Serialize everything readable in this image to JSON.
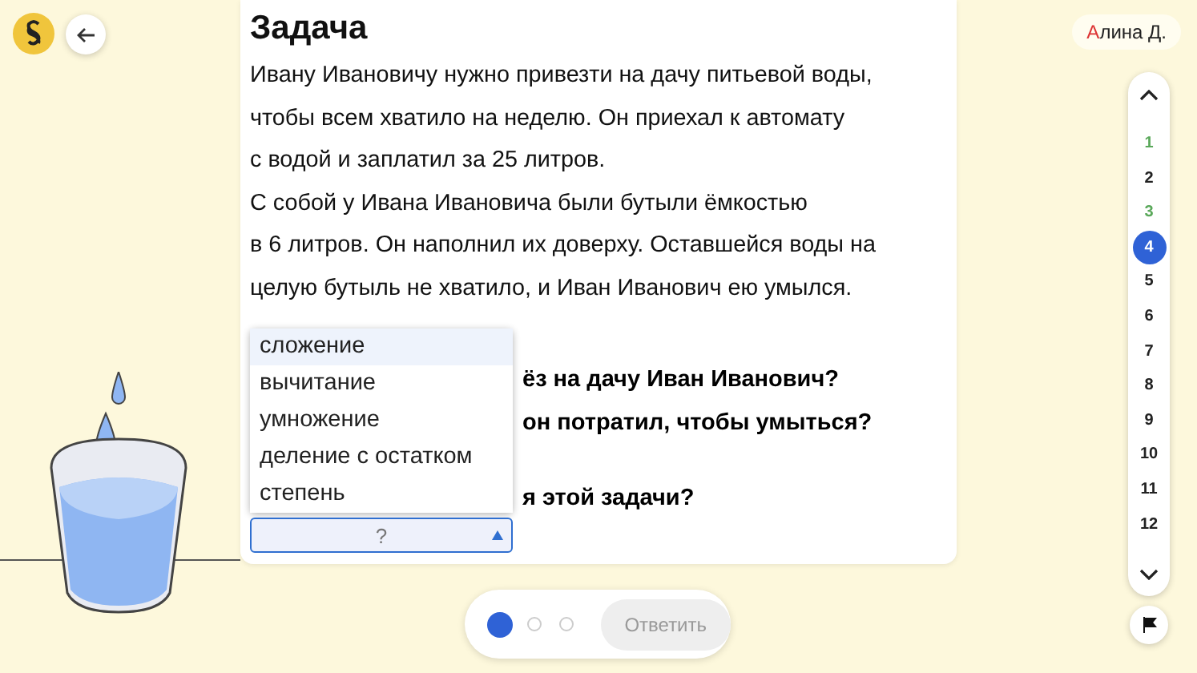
{
  "user": {
    "name": "Алина Д."
  },
  "task": {
    "title": "Задача",
    "paragraphs": [
      [
        "Ивану Ивановичу нужно привезти на дачу питьевой воды,",
        "чтобы всем хватило на неделю. Он приехал к автомату",
        "с водой и заплатил за 25 литров."
      ],
      [
        "С собой у Ивана Ивановича были бутыли ёмкостью",
        "в 6 литров. Он наполнил их доверху. Оставшейся воды на",
        "целую бутыль не хватило, и Иван Иванович ею умылся."
      ]
    ],
    "questions": [
      "ёз на дачу Иван Иванович?",
      "он потратил, чтобы умыться?",
      "я этой задачи?"
    ],
    "select": {
      "value": "?",
      "expanded": true,
      "options": [
        {
          "label": "сложение",
          "selected": true
        },
        {
          "label": "вычитание",
          "selected": false
        },
        {
          "label": "умножение",
          "selected": false
        },
        {
          "label": "деление с остатком",
          "selected": false
        },
        {
          "label": "степень",
          "selected": false
        }
      ]
    }
  },
  "nav": [
    {
      "label": "1",
      "done": true,
      "selected": false
    },
    {
      "label": "2",
      "done": false,
      "selected": false
    },
    {
      "label": "3",
      "done": true,
      "selected": false
    },
    {
      "label": "4",
      "done": false,
      "selected": true
    },
    {
      "label": "5",
      "done": false,
      "selected": false
    },
    {
      "label": "6",
      "done": false,
      "selected": false
    },
    {
      "label": "7",
      "done": false,
      "selected": false
    },
    {
      "label": "8",
      "done": false,
      "selected": false
    },
    {
      "label": "9",
      "done": false,
      "selected": false
    },
    {
      "label": "10",
      "done": false,
      "selected": false
    },
    {
      "label": "11",
      "done": false,
      "selected": false
    },
    {
      "label": "12",
      "done": false,
      "selected": false
    }
  ],
  "steps": [
    {
      "selected": true
    },
    {
      "selected": false
    },
    {
      "selected": false
    }
  ],
  "answer_button": {
    "label": "Ответить",
    "disabled": true
  }
}
